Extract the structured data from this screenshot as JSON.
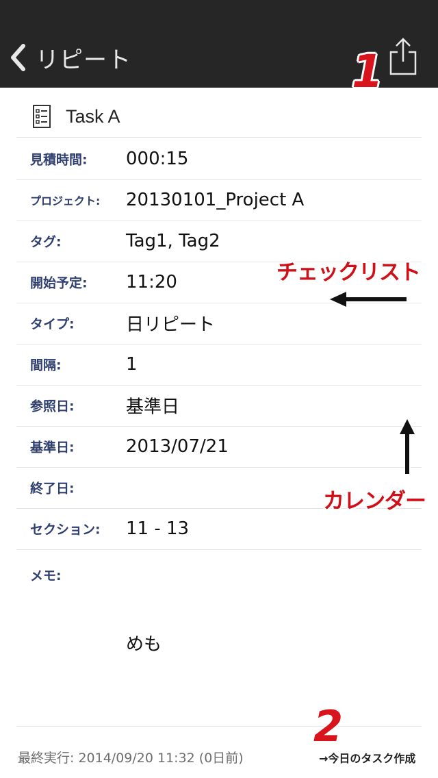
{
  "navbar": {
    "back_label": "リピート",
    "back_icon": "chevron-left-icon",
    "share_icon": "share-icon",
    "background": "#262626"
  },
  "task": {
    "icon": "checklist-icon",
    "title": "Task A"
  },
  "fields": [
    {
      "label": "見積時間:",
      "value": "000:15"
    },
    {
      "label": "プロジェクト:",
      "value": "20130101_Project A"
    },
    {
      "label": "タグ:",
      "value": "Tag1, Tag2"
    },
    {
      "label": "開始予定:",
      "value": "11:20"
    },
    {
      "label": "タイプ:",
      "value": "日リピート"
    },
    {
      "label": "間隔:",
      "value": "1"
    },
    {
      "label": "参照日:",
      "value": "基準日"
    },
    {
      "label": "基準日:",
      "value": "2013/07/21"
    },
    {
      "label": "終了日:",
      "value": ""
    },
    {
      "label": "セクション:",
      "value": "11 - 13"
    }
  ],
  "memo": {
    "label": "メモ:",
    "value": "めも"
  },
  "footer": {
    "last_run": "最終実行: 2014/09/20 11:32 (0日前)",
    "create_today_task": "→今日のタスク作成"
  },
  "annotations": {
    "badge_1": "1",
    "badge_2": "2",
    "checklist": "チェックリスト",
    "calendar": "カレンダー",
    "color": "#d01018"
  },
  "colors": {
    "label": "#2f3f6f",
    "value": "#111111",
    "footer_text": "#6e6e6e"
  }
}
